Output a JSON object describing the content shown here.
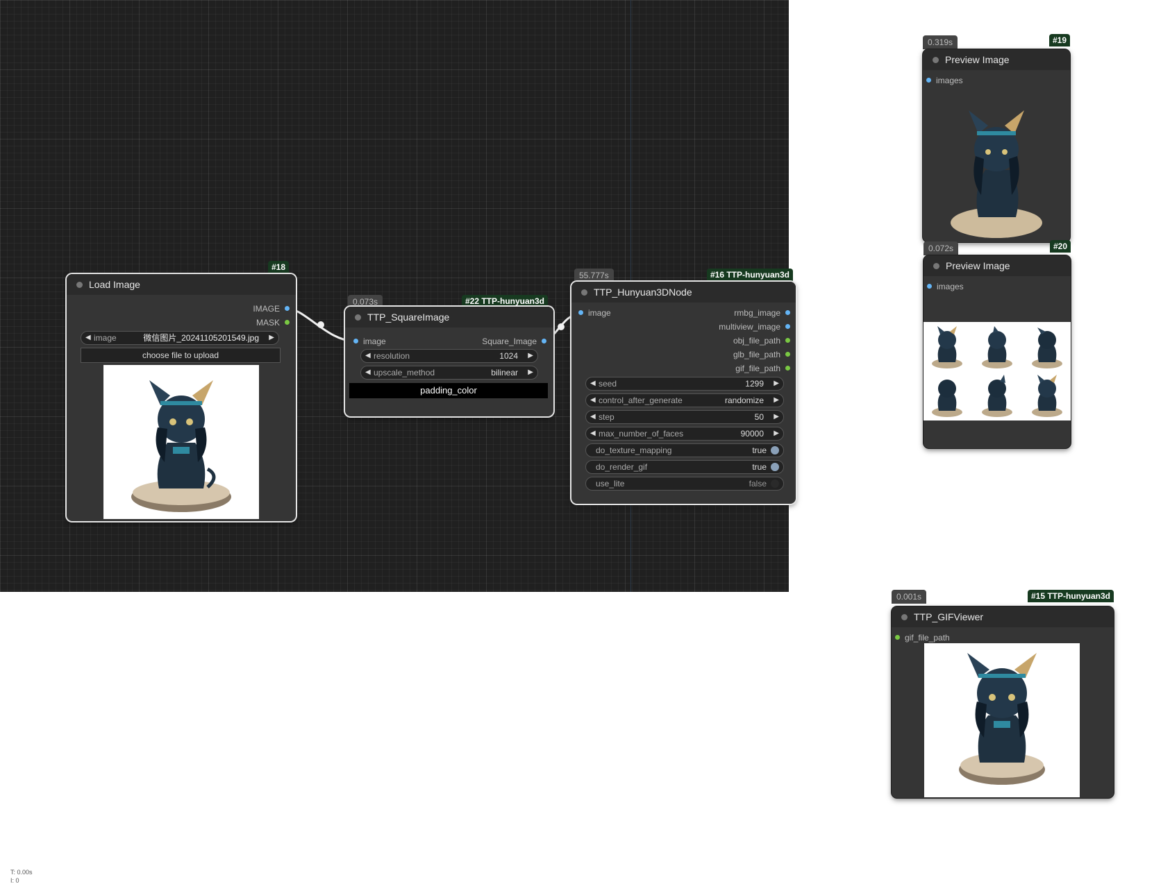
{
  "nodes": {
    "load_image": {
      "id": "#18",
      "title": "Load Image",
      "outputs": [
        "IMAGE",
        "MASK"
      ],
      "image_widget": {
        "label": "image",
        "value": "微信图片_20241105201549.jpg"
      },
      "upload_label": "choose file to upload"
    },
    "square_image": {
      "time": "0.073s",
      "id": "#22 TTP-hunyuan3d",
      "title": "TTP_SquareImage",
      "input": "image",
      "output": "Square_Image",
      "resolution": {
        "label": "resolution",
        "value": "1024"
      },
      "upscale_method": {
        "label": "upscale_method",
        "value": "bilinear"
      },
      "padding_color": "padding_color"
    },
    "hunyuan": {
      "time": "55.777s",
      "id": "#16 TTP-hunyuan3d",
      "title": "TTP_Hunyuan3DNode",
      "input": "image",
      "outputs": [
        "rmbg_image",
        "multiview_image",
        "obj_file_path",
        "glb_file_path",
        "gif_file_path"
      ],
      "seed": {
        "label": "seed",
        "value": "1299"
      },
      "control_after_generate": {
        "label": "control_after_generate",
        "value": "randomize"
      },
      "step": {
        "label": "step",
        "value": "50"
      },
      "max_faces": {
        "label": "max_number_of_faces",
        "value": "90000"
      },
      "texture": {
        "label": "do_texture_mapping",
        "value": "true"
      },
      "render_gif": {
        "label": "do_render_gif",
        "value": "true"
      },
      "use_lite": {
        "label": "use_lite",
        "value": "false"
      }
    },
    "preview19": {
      "time": "0.319s",
      "id": "#19",
      "title": "Preview Image",
      "input": "images"
    },
    "preview20": {
      "time": "0.072s",
      "id": "#20",
      "title": "Preview Image",
      "input": "images"
    },
    "gifviewer": {
      "time": "0.001s",
      "id": "#15 TTP-hunyuan3d",
      "title": "TTP_GIFViewer",
      "input": "gif_file_path"
    }
  },
  "status": {
    "time": "T: 0.00s",
    "iter": "I: 0"
  },
  "colors": {
    "canvas": "#202020",
    "node_body": "#353535",
    "node_title": "#2b2b2b",
    "badge": "#173a20",
    "pin_image": "#64b5f6",
    "pin_path": "#7ac943"
  },
  "icons": [
    "arrow-left-icon",
    "arrow-right-icon",
    "cat-figurine-image"
  ]
}
